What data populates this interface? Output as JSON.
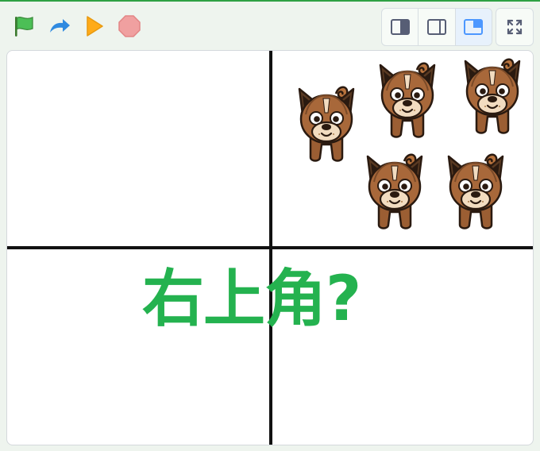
{
  "toolbar": {
    "controls": [
      {
        "icon": "green-flag-icon",
        "color": "#3b9c3b"
      },
      {
        "icon": "turbo-arrow-icon",
        "color": "#2f8ae0"
      },
      {
        "icon": "play-icon",
        "color": "#ffab19"
      },
      {
        "icon": "stop-icon",
        "color": "#f0a0a0"
      }
    ],
    "layout_modes": [
      "small-stage-icon",
      "normal-stage-icon",
      "large-stage-icon"
    ],
    "active_layout": "large-stage-icon",
    "fullscreen_icon": "fullscreen-icon"
  },
  "stage": {
    "say_text": "右上角?",
    "text_color": "#24b24f",
    "sprite_name": "dog-sprite-icon",
    "sprite_count": 5
  }
}
